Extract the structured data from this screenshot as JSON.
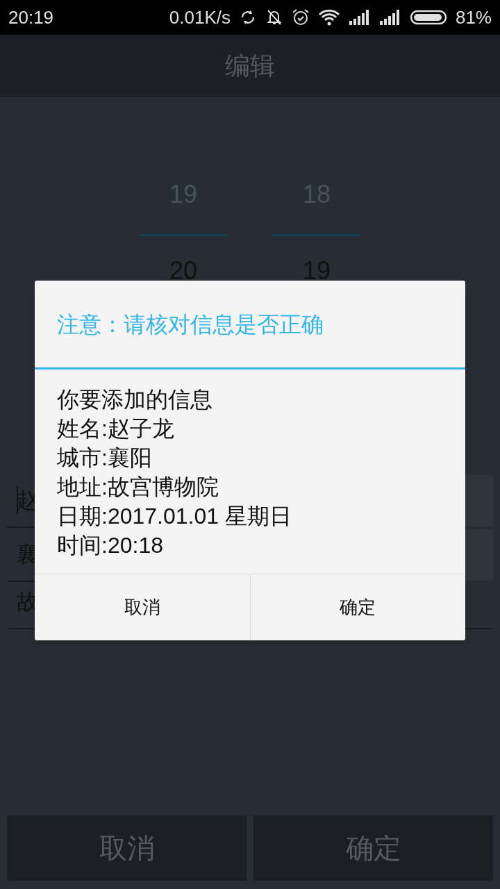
{
  "status_bar": {
    "time": "20:19",
    "net_speed": "0.01K/s",
    "battery": "81%"
  },
  "header": {
    "title": "编辑"
  },
  "time_picker": {
    "hour_prev": "19",
    "minute_prev": "18",
    "hour": "20",
    "minute": "19"
  },
  "form_fields": [
    {
      "value": "赵",
      "focused": true,
      "has_button": true
    },
    {
      "value": "襄",
      "focused": false,
      "has_button": true
    },
    {
      "value": "故",
      "focused": false,
      "has_button": false
    }
  ],
  "dialog": {
    "title": "注意：请核对信息是否正确",
    "lines": [
      "你要添加的信息",
      "姓名:赵子龙",
      "城市:襄阳",
      "地址:故宫博物院",
      "日期:2017.01.01 星期日",
      "时间:20:18"
    ],
    "buttons": [
      "取消",
      "确定"
    ]
  },
  "bottom_buttons": [
    "取消",
    "确定"
  ]
}
